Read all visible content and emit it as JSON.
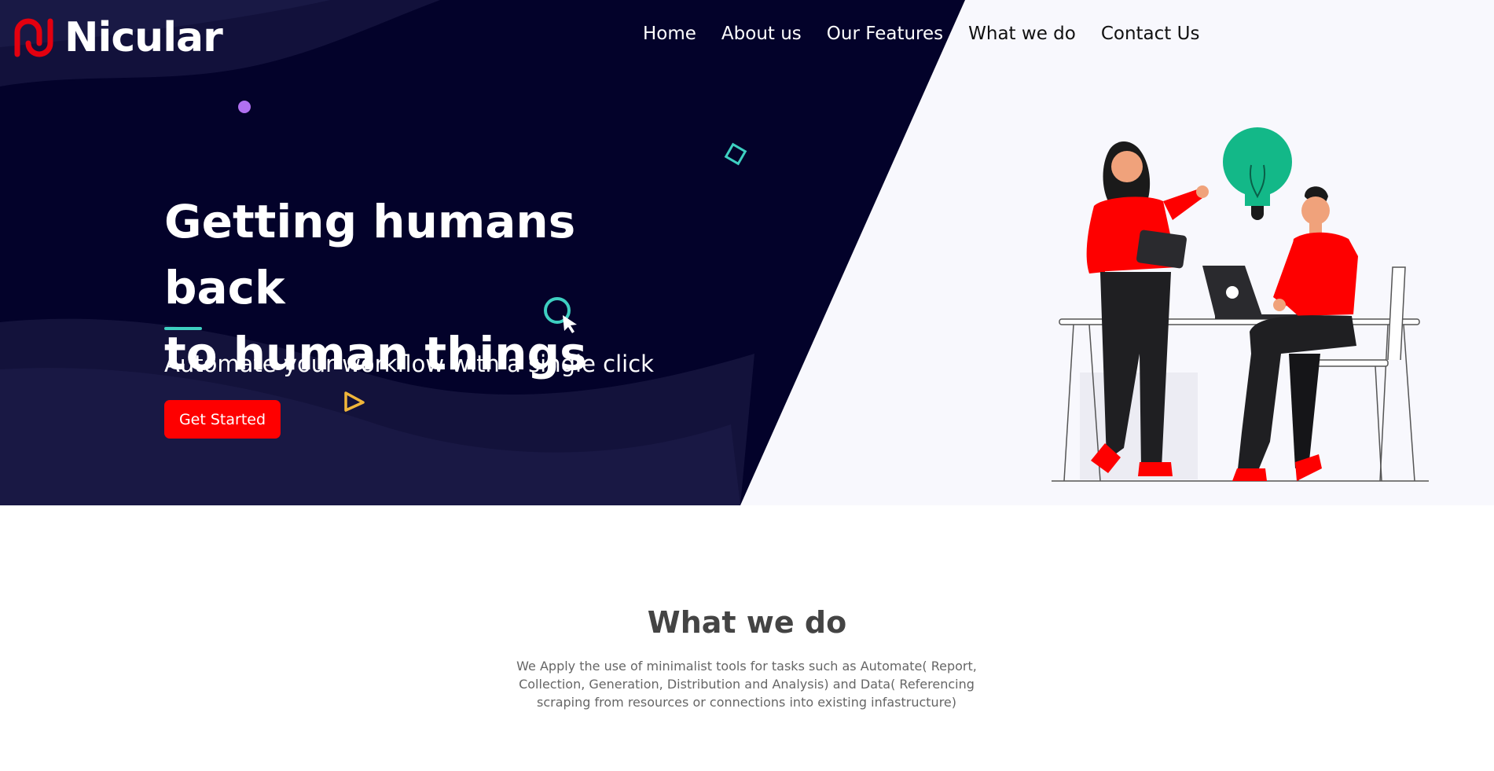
{
  "brand": {
    "name": "Nicular"
  },
  "nav": [
    {
      "label": "Home"
    },
    {
      "label": "About us"
    },
    {
      "label": "Our Features"
    },
    {
      "label": "What we do"
    },
    {
      "label": "Contact Us"
    }
  ],
  "hero": {
    "headline_line1": "Getting humans back",
    "headline_line2": "to human things",
    "subtitle": "Automate your workflow with a single click",
    "cta_label": "Get Started"
  },
  "section": {
    "title": "What we do",
    "text": "We Apply the use of minimalist tools for tasks such as Automate( Report, Collection, Generation, Distribution and Analysis) and Data( Referencing scraping from resources or connections into existing infastructure)"
  },
  "colors": {
    "hero_dark": "#03022a",
    "hero_light": "#f8f8fd",
    "accent_red": "#fe0000",
    "accent_teal": "#3ecfc1",
    "bulb_green": "#13b888"
  },
  "icons": [
    "logo-icon",
    "dot-icon",
    "diamond-icon",
    "cursor-icon",
    "triangle-icon",
    "lightbulb-icon",
    "laptop-icon",
    "tablet-icon"
  ]
}
